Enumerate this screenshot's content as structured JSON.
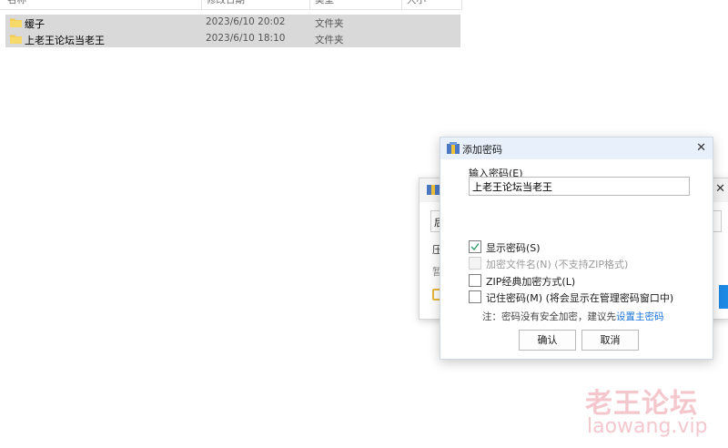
{
  "file_list": {
    "columns": [
      "名称",
      "修改日期",
      "类型",
      "大小"
    ],
    "rows": [
      {
        "name": "缓子",
        "modified": "2023/6/10 20:02",
        "type": "文件夹"
      },
      {
        "name": "上老王论坛当老王",
        "modified": "2023/6/10 18:10",
        "type": "文件夹"
      }
    ]
  },
  "background_dialog": {
    "input_char": "后",
    "line1": "压",
    "line2": "暂"
  },
  "password_dialog": {
    "title": "添加密码",
    "close": "✕",
    "input_label": "输入密码(E)",
    "password_value": "上老王论坛当老王",
    "options": [
      {
        "label": "显示密码(S)",
        "checked": true,
        "disabled": false
      },
      {
        "label": "加密文件名(N) (不支持ZIP格式)",
        "checked": false,
        "disabled": true
      },
      {
        "label": "ZIP经典加密方式(L)",
        "checked": false,
        "disabled": false
      },
      {
        "label": "记住密码(M) (将会显示在管理密码窗口中)",
        "checked": false,
        "disabled": false
      }
    ],
    "note_prefix": "注：密码没有安全加密，建议先",
    "note_link": "设置主密码",
    "ok_label": "确认",
    "cancel_label": "取消"
  },
  "watermark": {
    "line1": "老王论坛",
    "line2": "laowang.vip"
  },
  "colors": {
    "selected_row": "#d9d9d9",
    "titlebar": "#e8f0fb",
    "link": "#1a73d9",
    "check": "#2e9b6a",
    "watermark": "#f4c7cd"
  }
}
